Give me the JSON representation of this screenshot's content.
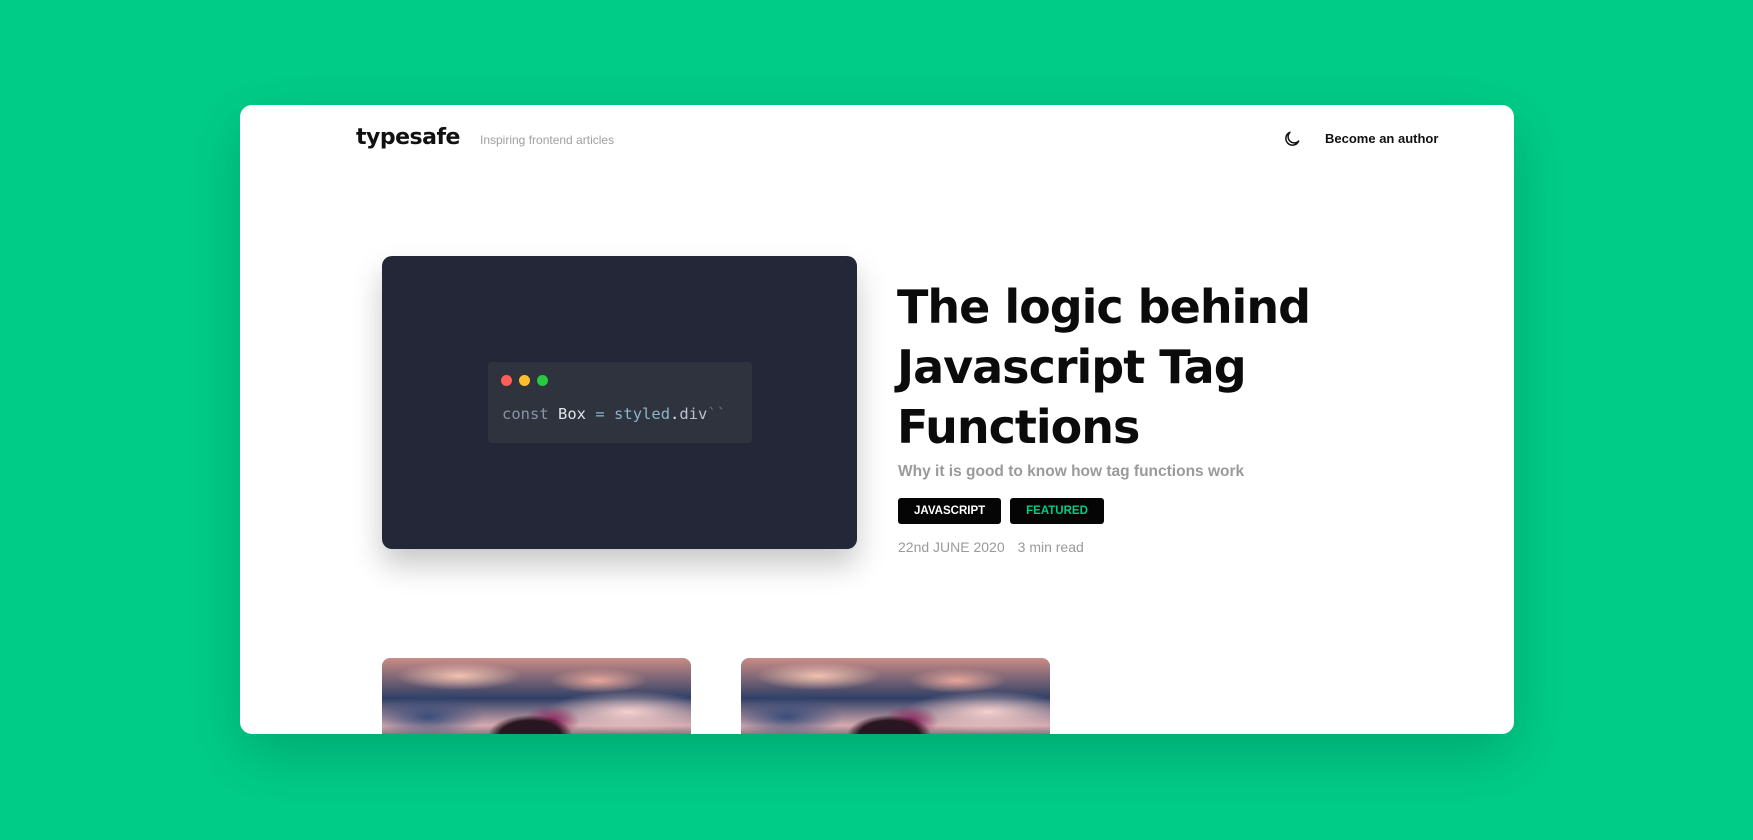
{
  "header": {
    "logo": "typesafe",
    "tagline": "Inspiring frontend articles",
    "theme_icon": "moon-icon",
    "author_link": "Become an author"
  },
  "featured": {
    "image": {
      "window_dots": [
        "#ff5f56",
        "#ffbd2e",
        "#27c93f"
      ],
      "code": {
        "keyword": "const",
        "identifier": "Box",
        "operator": "=",
        "callee": "styled",
        "dot": ".",
        "property": "div",
        "template": "``"
      }
    },
    "title": "The logic behind Javascript Tag Functions",
    "subtitle": "Why it is good to know how tag functions work",
    "tags": [
      {
        "label": "JAVASCRIPT",
        "color": "#ffffff"
      },
      {
        "label": "FEATURED",
        "color": "#00cc88"
      }
    ],
    "date": "22nd JUNE 2020",
    "read_time": "3 min read"
  },
  "colors": {
    "background": "#00cc88",
    "card": "#ffffff",
    "code_bg": "#242738",
    "code_window": "#2f333e",
    "text_dark": "#0b0b0b",
    "text_muted": "#9a9a9a"
  }
}
